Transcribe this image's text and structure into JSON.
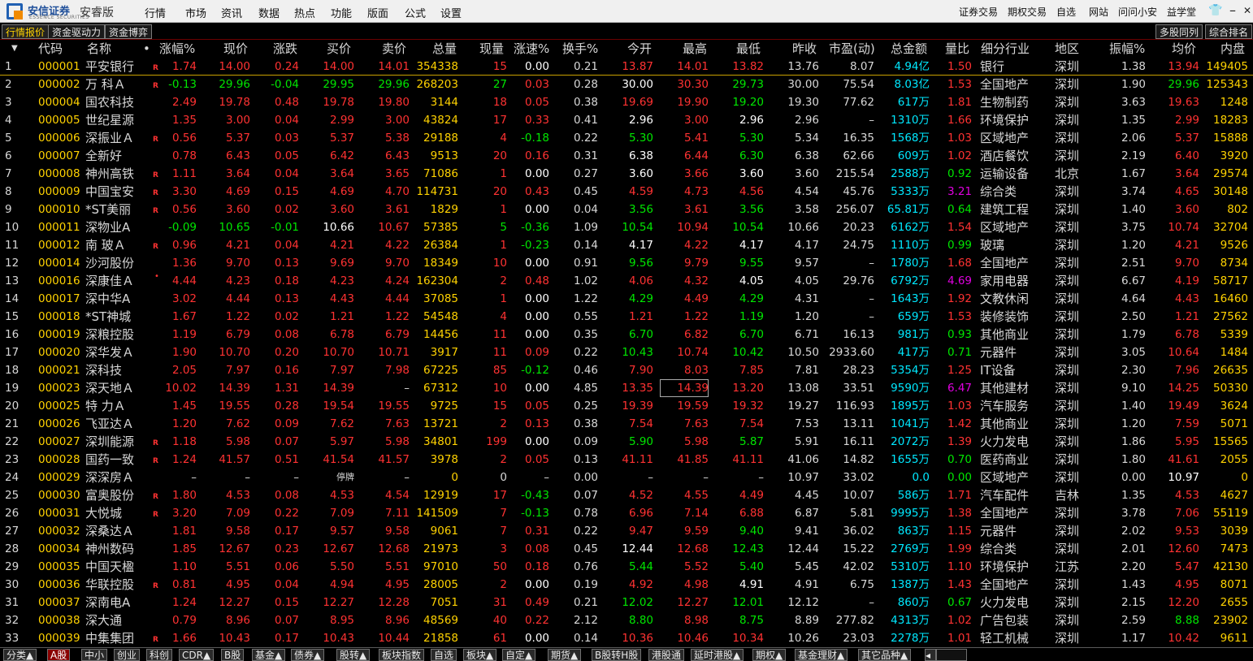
{
  "window": {
    "brand": "安信证券",
    "brand_sub": "ESSENCE SECURITIES",
    "edition": "安睿版",
    "menu_left": [
      "行情",
      "市场",
      "资讯",
      "数据",
      "热点",
      "功能",
      "版面",
      "公式",
      "设置"
    ],
    "menu_right": [
      "证券交易",
      "期权交易",
      "自选",
      "网站",
      "问问小安",
      "益学堂"
    ],
    "controls": [
      "shirt-icon",
      "minimize-icon",
      "maximize-icon",
      "close-icon"
    ]
  },
  "tabs_left": [
    {
      "label": "行情报价",
      "active": true
    },
    {
      "label": "资金驱动力",
      "active": false
    },
    {
      "label": "资金博弈",
      "active": false
    }
  ],
  "tabs_right": [
    {
      "label": "多股同列"
    },
    {
      "label": "综合排名"
    }
  ],
  "columns": [
    "",
    "代码",
    "名称",
    "•",
    "涨幅%",
    "现价",
    "涨跌",
    "买价",
    "卖价",
    "总量",
    "现量",
    "涨速%",
    "换手%",
    "今开",
    "最高",
    "最低",
    "昨收",
    "市盈(动)",
    "总金额",
    "量比",
    "细分行业",
    "地区",
    "振幅%",
    "均价",
    "内盘"
  ],
  "colors": {
    "up": "#ff3232",
    "down": "#00e600",
    "flat": "#ffffff",
    "volume": "#ffd200",
    "amount": "#00e8ff",
    "purple": "#e000e0",
    "code": "#ffd200",
    "text": "#d8d8d8"
  },
  "rows": [
    [
      "1",
      "000001",
      "平安银行",
      "R",
      "1.74",
      "14.00",
      "0.24",
      "14.00",
      "14.01",
      "354338",
      "15",
      "0.00",
      "0.21",
      "13.87",
      "14.01",
      "13.82",
      "13.76",
      "8.07",
      "4.94亿",
      "1.50",
      "银行",
      "深圳",
      "1.38",
      "13.94",
      "149405"
    ],
    [
      "2",
      "000002",
      "万 科Ａ",
      "R",
      "-0.13",
      "29.96",
      "-0.04",
      "29.95",
      "29.96",
      "268203",
      "27",
      "0.03",
      "0.28",
      "30.00",
      "30.30",
      "29.73",
      "30.00",
      "75.54",
      "8.03亿",
      "1.53",
      "全国地产",
      "深圳",
      "1.90",
      "29.96",
      "125343"
    ],
    [
      "3",
      "000004",
      "国农科技",
      "",
      "2.49",
      "19.78",
      "0.48",
      "19.78",
      "19.80",
      "3144",
      "18",
      "0.05",
      "0.38",
      "19.69",
      "19.90",
      "19.20",
      "19.30",
      "77.62",
      "617万",
      "1.81",
      "生物制药",
      "深圳",
      "3.63",
      "19.63",
      "1248"
    ],
    [
      "4",
      "000005",
      "世纪星源",
      "",
      "1.35",
      "3.00",
      "0.04",
      "2.99",
      "3.00",
      "43824",
      "17",
      "0.33",
      "0.41",
      "2.96",
      "3.00",
      "2.96",
      "2.96",
      "–",
      "1310万",
      "1.66",
      "环境保护",
      "深圳",
      "1.35",
      "2.99",
      "18283"
    ],
    [
      "5",
      "000006",
      "深振业Ａ",
      "R",
      "0.56",
      "5.37",
      "0.03",
      "5.37",
      "5.38",
      "29188",
      "4",
      "-0.18",
      "0.22",
      "5.30",
      "5.41",
      "5.30",
      "5.34",
      "16.35",
      "1568万",
      "1.03",
      "区域地产",
      "深圳",
      "2.06",
      "5.37",
      "15888"
    ],
    [
      "6",
      "000007",
      "全新好",
      "",
      "0.78",
      "6.43",
      "0.05",
      "6.42",
      "6.43",
      "9513",
      "20",
      "0.16",
      "0.31",
      "6.38",
      "6.44",
      "6.30",
      "6.38",
      "62.66",
      "609万",
      "1.02",
      "酒店餐饮",
      "深圳",
      "2.19",
      "6.40",
      "3920"
    ],
    [
      "7",
      "000008",
      "神州高铁",
      "R",
      "1.11",
      "3.64",
      "0.04",
      "3.64",
      "3.65",
      "71086",
      "1",
      "0.00",
      "0.27",
      "3.60",
      "3.66",
      "3.60",
      "3.60",
      "215.54",
      "2588万",
      "0.92",
      "运输设备",
      "北京",
      "1.67",
      "3.64",
      "29574"
    ],
    [
      "8",
      "000009",
      "中国宝安",
      "R",
      "3.30",
      "4.69",
      "0.15",
      "4.69",
      "4.70",
      "114731",
      "20",
      "0.43",
      "0.45",
      "4.59",
      "4.73",
      "4.56",
      "4.54",
      "45.76",
      "5333万",
      "3.21",
      "综合类",
      "深圳",
      "3.74",
      "4.65",
      "30148"
    ],
    [
      "9",
      "000010",
      "*ST美丽",
      "R",
      "0.56",
      "3.60",
      "0.02",
      "3.60",
      "3.61",
      "1829",
      "1",
      "0.00",
      "0.04",
      "3.56",
      "3.61",
      "3.56",
      "3.58",
      "256.07",
      "65.81万",
      "0.64",
      "建筑工程",
      "深圳",
      "1.40",
      "3.60",
      "802"
    ],
    [
      "10",
      "000011",
      "深物业A",
      "",
      "-0.09",
      "10.65",
      "-0.01",
      "10.66",
      "10.67",
      "57385",
      "5",
      "-0.36",
      "1.09",
      "10.54",
      "10.94",
      "10.54",
      "10.66",
      "20.23",
      "6162万",
      "1.54",
      "区域地产",
      "深圳",
      "3.75",
      "10.74",
      "32704"
    ],
    [
      "11",
      "000012",
      "南 玻Ａ",
      "R",
      "0.96",
      "4.21",
      "0.04",
      "4.21",
      "4.22",
      "26384",
      "1",
      "-0.23",
      "0.14",
      "4.17",
      "4.22",
      "4.17",
      "4.17",
      "24.75",
      "1110万",
      "0.99",
      "玻璃",
      "深圳",
      "1.20",
      "4.21",
      "9526"
    ],
    [
      "12",
      "000014",
      "沙河股份",
      "",
      "1.36",
      "9.70",
      "0.13",
      "9.69",
      "9.70",
      "18349",
      "10",
      "0.00",
      "0.91",
      "9.56",
      "9.79",
      "9.55",
      "9.57",
      "–",
      "1780万",
      "1.68",
      "全国地产",
      "深圳",
      "2.51",
      "9.70",
      "8734"
    ],
    [
      "13",
      "000016",
      "深康佳Ａ",
      "",
      "4.44",
      "4.23",
      "0.18",
      "4.23",
      "4.24",
      "162304",
      "2",
      "0.48",
      "1.02",
      "4.06",
      "4.32",
      "4.05",
      "4.05",
      "29.76",
      "6792万",
      "4.69",
      "家用电器",
      "深圳",
      "6.67",
      "4.19",
      "58717"
    ],
    [
      "14",
      "000017",
      "深中华A",
      "",
      "3.02",
      "4.44",
      "0.13",
      "4.43",
      "4.44",
      "37085",
      "1",
      "0.00",
      "1.22",
      "4.29",
      "4.49",
      "4.29",
      "4.31",
      "–",
      "1643万",
      "1.92",
      "文教休闲",
      "深圳",
      "4.64",
      "4.43",
      "16460"
    ],
    [
      "15",
      "000018",
      "*ST神城",
      "",
      "1.67",
      "1.22",
      "0.02",
      "1.21",
      "1.22",
      "54548",
      "4",
      "0.00",
      "0.55",
      "1.21",
      "1.22",
      "1.19",
      "1.20",
      "–",
      "659万",
      "1.53",
      "装修装饰",
      "深圳",
      "2.50",
      "1.21",
      "27562"
    ],
    [
      "16",
      "000019",
      "深粮控股",
      "",
      "1.19",
      "6.79",
      "0.08",
      "6.78",
      "6.79",
      "14456",
      "11",
      "0.00",
      "0.35",
      "6.70",
      "6.82",
      "6.70",
      "6.71",
      "16.13",
      "981万",
      "0.93",
      "其他商业",
      "深圳",
      "1.79",
      "6.78",
      "5339"
    ],
    [
      "17",
      "000020",
      "深华发Ａ",
      "",
      "1.90",
      "10.70",
      "0.20",
      "10.70",
      "10.71",
      "3917",
      "11",
      "0.09",
      "0.22",
      "10.43",
      "10.74",
      "10.42",
      "10.50",
      "2933.60",
      "417万",
      "0.71",
      "元器件",
      "深圳",
      "3.05",
      "10.64",
      "1484"
    ],
    [
      "18",
      "000021",
      "深科技",
      "",
      "2.05",
      "7.97",
      "0.16",
      "7.97",
      "7.98",
      "67225",
      "85",
      "-0.12",
      "0.46",
      "7.90",
      "8.03",
      "7.85",
      "7.81",
      "28.23",
      "5354万",
      "1.25",
      "IT设备",
      "深圳",
      "2.30",
      "7.96",
      "26635"
    ],
    [
      "19",
      "000023",
      "深天地Ａ",
      "",
      "10.02",
      "14.39",
      "1.31",
      "14.39",
      "–",
      "67312",
      "10",
      "0.00",
      "4.85",
      "13.35",
      "14.39",
      "13.20",
      "13.08",
      "33.51",
      "9590万",
      "6.47",
      "其他建材",
      "深圳",
      "9.10",
      "14.25",
      "50330"
    ],
    [
      "20",
      "000025",
      "特 力Ａ",
      "",
      "1.45",
      "19.55",
      "0.28",
      "19.54",
      "19.55",
      "9725",
      "15",
      "0.05",
      "0.25",
      "19.39",
      "19.59",
      "19.32",
      "19.27",
      "116.93",
      "1895万",
      "1.03",
      "汽车服务",
      "深圳",
      "1.40",
      "19.49",
      "3624"
    ],
    [
      "21",
      "000026",
      "飞亚达Ａ",
      "",
      "1.20",
      "7.62",
      "0.09",
      "7.62",
      "7.63",
      "13721",
      "2",
      "0.13",
      "0.38",
      "7.54",
      "7.63",
      "7.54",
      "7.53",
      "13.11",
      "1041万",
      "1.42",
      "其他商业",
      "深圳",
      "1.20",
      "7.59",
      "5071"
    ],
    [
      "22",
      "000027",
      "深圳能源",
      "R",
      "1.18",
      "5.98",
      "0.07",
      "5.97",
      "5.98",
      "34801",
      "199",
      "0.00",
      "0.09",
      "5.90",
      "5.98",
      "5.87",
      "5.91",
      "16.11",
      "2072万",
      "1.39",
      "火力发电",
      "深圳",
      "1.86",
      "5.95",
      "15565"
    ],
    [
      "23",
      "000028",
      "国药一致",
      "R",
      "1.24",
      "41.57",
      "0.51",
      "41.54",
      "41.57",
      "3978",
      "2",
      "0.05",
      "0.13",
      "41.11",
      "41.85",
      "41.11",
      "41.06",
      "14.82",
      "1655万",
      "0.70",
      "医药商业",
      "深圳",
      "1.80",
      "41.61",
      "2055"
    ],
    [
      "24",
      "000029",
      "深深房Ａ",
      "",
      "–",
      "–",
      "–",
      "停牌",
      "–",
      "0",
      "0",
      "–",
      "0.00",
      "–",
      "–",
      "–",
      "10.97",
      "33.02",
      "0.0",
      "0.00",
      "区域地产",
      "深圳",
      "0.00",
      "10.97",
      "0"
    ],
    [
      "25",
      "000030",
      "富奥股份",
      "R",
      "1.80",
      "4.53",
      "0.08",
      "4.53",
      "4.54",
      "12919",
      "17",
      "-0.43",
      "0.07",
      "4.52",
      "4.55",
      "4.49",
      "4.45",
      "10.07",
      "586万",
      "1.71",
      "汽车配件",
      "吉林",
      "1.35",
      "4.53",
      "4627"
    ],
    [
      "26",
      "000031",
      "大悦城",
      "R",
      "3.20",
      "7.09",
      "0.22",
      "7.09",
      "7.11",
      "141509",
      "7",
      "-0.13",
      "0.78",
      "6.96",
      "7.14",
      "6.88",
      "6.87",
      "5.81",
      "9995万",
      "1.38",
      "全国地产",
      "深圳",
      "3.78",
      "7.06",
      "55119"
    ],
    [
      "27",
      "000032",
      "深桑达Ａ",
      "",
      "1.81",
      "9.58",
      "0.17",
      "9.57",
      "9.58",
      "9061",
      "7",
      "0.31",
      "0.22",
      "9.47",
      "9.59",
      "9.40",
      "9.41",
      "36.02",
      "863万",
      "1.15",
      "元器件",
      "深圳",
      "2.02",
      "9.53",
      "3039"
    ],
    [
      "28",
      "000034",
      "神州数码",
      "",
      "1.85",
      "12.67",
      "0.23",
      "12.67",
      "12.68",
      "21973",
      "3",
      "0.08",
      "0.45",
      "12.44",
      "12.68",
      "12.43",
      "12.44",
      "15.22",
      "2769万",
      "1.99",
      "综合类",
      "深圳",
      "2.01",
      "12.60",
      "7473"
    ],
    [
      "29",
      "000035",
      "中国天楹",
      "",
      "1.10",
      "5.51",
      "0.06",
      "5.50",
      "5.51",
      "97010",
      "50",
      "0.18",
      "0.76",
      "5.44",
      "5.52",
      "5.40",
      "5.45",
      "42.02",
      "5310万",
      "1.10",
      "环境保护",
      "江苏",
      "2.20",
      "5.47",
      "42130"
    ],
    [
      "30",
      "000036",
      "华联控股",
      "R",
      "0.81",
      "4.95",
      "0.04",
      "4.94",
      "4.95",
      "28005",
      "2",
      "0.00",
      "0.19",
      "4.92",
      "4.98",
      "4.91",
      "4.91",
      "6.75",
      "1387万",
      "1.43",
      "全国地产",
      "深圳",
      "1.43",
      "4.95",
      "8071"
    ],
    [
      "31",
      "000037",
      "深南电A",
      "",
      "1.24",
      "12.27",
      "0.15",
      "12.27",
      "12.28",
      "7051",
      "31",
      "0.49",
      "0.21",
      "12.02",
      "12.27",
      "12.01",
      "12.12",
      "–",
      "860万",
      "0.67",
      "火力发电",
      "深圳",
      "2.15",
      "12.20",
      "2655"
    ],
    [
      "32",
      "000038",
      "深大通",
      "",
      "0.79",
      "8.96",
      "0.07",
      "8.95",
      "8.96",
      "48569",
      "40",
      "0.22",
      "2.12",
      "8.80",
      "8.98",
      "8.75",
      "8.89",
      "277.82",
      "4313万",
      "1.02",
      "广告包装",
      "深圳",
      "2.59",
      "8.88",
      "23902"
    ],
    [
      "33",
      "000039",
      "中集集团",
      "R",
      "1.66",
      "10.43",
      "0.17",
      "10.43",
      "10.44",
      "21858",
      "61",
      "0.00",
      "0.14",
      "10.36",
      "10.46",
      "10.34",
      "10.26",
      "23.03",
      "2278万",
      "1.01",
      "轻工机械",
      "深圳",
      "1.17",
      "10.42",
      "9611"
    ]
  ],
  "bottom_tabs": [
    {
      "label": "分类▲",
      "active": false
    },
    {
      "label": "A股",
      "active": true
    },
    {
      "label": "中小",
      "active": false
    },
    {
      "label": "创业",
      "active": false
    },
    {
      "label": "科创",
      "active": false
    },
    {
      "label": "CDR▲",
      "active": false
    },
    {
      "label": "B股",
      "active": false
    },
    {
      "label": "基金▲",
      "active": false
    },
    {
      "label": "债券▲",
      "active": false
    },
    {
      "label": "股转▲",
      "active": false
    },
    {
      "label": "板块指数",
      "active": false
    },
    {
      "label": "自选",
      "active": false
    },
    {
      "label": "板块▲",
      "active": false
    },
    {
      "label": "自定▲",
      "active": false
    },
    {
      "label": "期货▲",
      "active": false
    },
    {
      "label": "B股转H股",
      "active": false
    },
    {
      "label": "港股通",
      "active": false
    },
    {
      "label": "延时港股▲",
      "active": false
    },
    {
      "label": "期权▲",
      "active": false
    },
    {
      "label": "基金理财▲",
      "active": false
    },
    {
      "label": "其它品种▲",
      "active": false
    }
  ]
}
